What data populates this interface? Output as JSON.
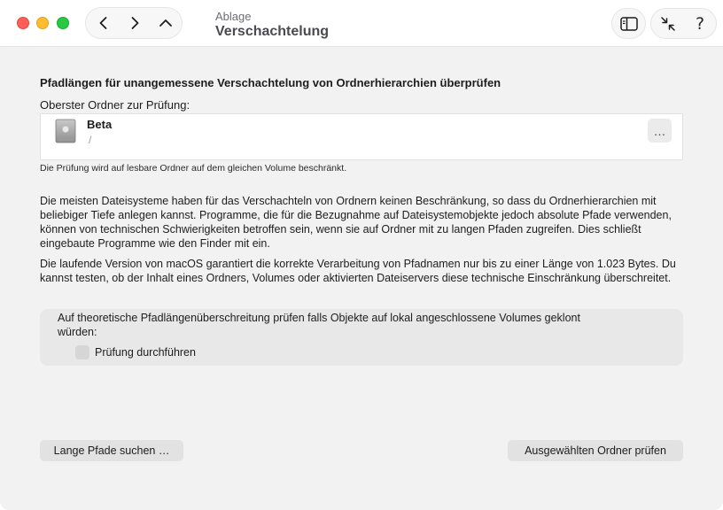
{
  "titlebar": {
    "subtitle": "Ablage",
    "title": "Verschachtelung",
    "help_label": "?"
  },
  "content": {
    "heading": "Pfadlängen für unangemessene Verschachtelung von Ordnerhierarchien überprüfen",
    "folder_label": "Oberster Ordner zur Prüfung:",
    "folder": {
      "name": "Beta",
      "path": "/",
      "more_label": "…"
    },
    "note": "Die Prüfung wird auf lesbare Ordner auf dem gleichen Volume beschränkt.",
    "paragraph1": "Die meisten Dateisysteme haben für das Verschachteln von Ordnern keinen Beschränkung, so dass du Ordnerhierarchien mit beliebiger Tiefe anlegen kannst. Programme, die für die Bezugnahme auf Dateisystemobjekte jedoch absolute Pfade verwenden, können von technischen Schwierigkeiten betroffen sein, wenn sie auf Ordner mit zu langen Pfaden zugreifen. Dies schließt eingebaute Programme wie den Finder mit ein.",
    "paragraph2": "Die laufende Version von macOS garantiert die korrekte Verarbeitung von Pfadnamen nur bis zu einer Länge von 1.023 Bytes. Du kannst testen, ob der Inhalt eines Ordners, Volumes oder aktivierten Dateiservers diese technische Einschränkung überschreitet.",
    "option": {
      "text": "Auf theoretische Pfadlängenüberschreitung prüfen falls Objekte auf lokal angeschlossene Volumes geklont würden:",
      "checkbox_label": "Prüfung durchführen",
      "checked": false
    }
  },
  "buttons": {
    "find_long_paths": "Lange Pfade suchen …",
    "check_folder": "Ausgewählten Ordner prüfen"
  }
}
